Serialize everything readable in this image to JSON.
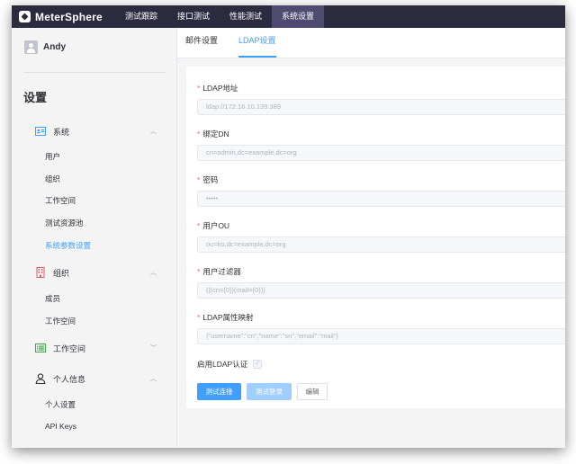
{
  "app": {
    "brand": "MeterSphere"
  },
  "topnav": {
    "items": [
      {
        "label": "测试跟踪",
        "active": false
      },
      {
        "label": "接口测试",
        "active": false
      },
      {
        "label": "性能测试",
        "active": false
      },
      {
        "label": "系统设置",
        "active": true
      }
    ],
    "colors": {
      "bar": "#2c2a3f",
      "active": "#4f4b71"
    }
  },
  "sidebar": {
    "user_name": "Andy",
    "title": "设置",
    "groups": [
      {
        "label": "系统",
        "icon": "id-card-icon",
        "expanded": true,
        "items": [
          {
            "label": "用户",
            "active": false
          },
          {
            "label": "组织",
            "active": false
          },
          {
            "label": "工作空间",
            "active": false
          },
          {
            "label": "测试资源池",
            "active": false
          },
          {
            "label": "系统参数设置",
            "active": true
          }
        ]
      },
      {
        "label": "组织",
        "icon": "building-icon",
        "expanded": true,
        "items": [
          {
            "label": "成员",
            "active": false
          },
          {
            "label": "工作空间",
            "active": false
          }
        ]
      },
      {
        "label": "工作空间",
        "icon": "list-icon",
        "expanded": false,
        "items": []
      },
      {
        "label": "个人信息",
        "icon": "person-icon",
        "expanded": true,
        "items": [
          {
            "label": "个人设置",
            "active": false
          },
          {
            "label": "API Keys",
            "active": false
          }
        ]
      }
    ]
  },
  "tabs": [
    {
      "label": "邮件设置",
      "active": false
    },
    {
      "label": "LDAP设置",
      "active": true
    }
  ],
  "form": {
    "fields": [
      {
        "label": "LDAP地址",
        "placeholder": "ldap://172.16.10.139:389"
      },
      {
        "label": "绑定DN",
        "placeholder": "cn=admin,dc=example,dc=org"
      },
      {
        "label": "密码",
        "placeholder": "•••••"
      },
      {
        "label": "用户OU",
        "placeholder": "ou=ko,dc=example,dc=org"
      },
      {
        "label": "用户过滤器",
        "placeholder": "(|(cn={0})(mail={0}))"
      },
      {
        "label": "LDAP属性映射",
        "placeholder": "{\"username\":\"cn\",\"name\":\"sn\",\"email\":\"mail\"}"
      }
    ],
    "required_mark": "*",
    "enable_label": "启用LDAP认证",
    "enable_checked": true,
    "buttons": {
      "test_connection": "测试连接",
      "test_login": "测试登录",
      "edit": "编辑"
    }
  },
  "colors": {
    "accent": "#409eff",
    "required": "#f56c6c"
  }
}
